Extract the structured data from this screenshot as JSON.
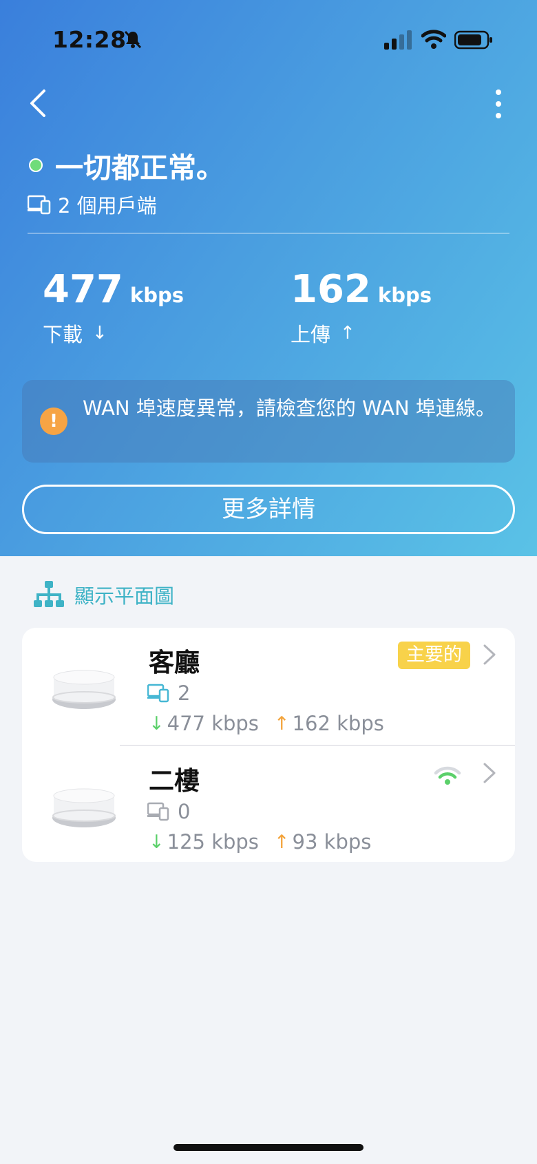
{
  "status_bar": {
    "time": "12:28",
    "icons": [
      "bell-muted-icon",
      "cellular-signal-icon",
      "wifi-icon",
      "battery-icon"
    ]
  },
  "header": {
    "back_icon": "chevron-left-icon",
    "more_icon": "more-vertical-icon",
    "status_text": "一切都正常。",
    "status_color": "#6fdc7a",
    "clients_text": "2 個用戶端"
  },
  "speeds": {
    "download_value": "477",
    "download_unit": "kbps",
    "download_label": "下載",
    "download_arrow": "↓",
    "upload_value": "162",
    "upload_unit": "kbps",
    "upload_label": "上傳",
    "upload_arrow": "↑"
  },
  "alert": {
    "icon": "warning-icon",
    "icon_glyph": "!",
    "text": "WAN 埠速度異常，請檢查您的 WAN 埠連線。",
    "color": "#f6a445"
  },
  "details_button": {
    "label": "更多詳情"
  },
  "topology_link": {
    "label": "顯示平面圖",
    "icon": "network-topology-icon",
    "color": "#3fb3c6"
  },
  "nodes": [
    {
      "name": "客廳",
      "badge": "主要的",
      "clients": "2",
      "down": "477 kbps",
      "up": "162 kbps",
      "down_arrow": "↓",
      "up_arrow": "↑"
    },
    {
      "name": "二樓",
      "clients": "0",
      "down": "125 kbps",
      "up": "93 kbps",
      "down_arrow": "↓",
      "up_arrow": "↑",
      "signal_icon": "wifi-signal-icon"
    }
  ],
  "colors": {
    "accent_teal": "#3fb3c6",
    "badge_yellow": "#f8d24a",
    "down_green": "#5bd06a",
    "up_orange": "#f3a33a"
  }
}
